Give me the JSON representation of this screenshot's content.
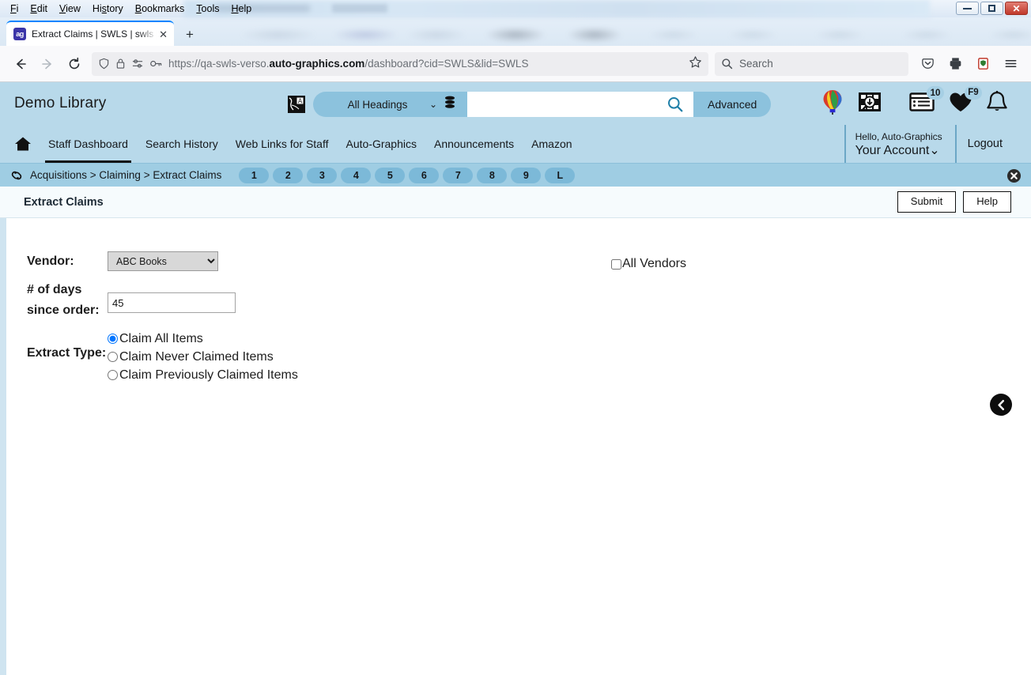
{
  "window": {
    "menus": [
      "File",
      "Edit",
      "View",
      "History",
      "Bookmarks",
      "Tools",
      "Help"
    ],
    "minimize_label": "Minimize",
    "maximize_label": "Maximize",
    "close_label": "Close"
  },
  "browser": {
    "tab": {
      "title": "Extract Claims | SWLS | swls | Au",
      "favicon_text": "ag",
      "close_label": "✕"
    },
    "new_tab_label": "+",
    "back_icon": "arrow-left-icon",
    "forward_icon": "arrow-right-icon",
    "reload_icon": "reload-icon",
    "url": {
      "prefix": "https://qa-swls-verso.",
      "domain": "auto-graphics.com",
      "suffix": "/dashboard?cid=SWLS&lid=SWLS"
    },
    "search": {
      "placeholder": "Search"
    }
  },
  "app": {
    "library_name": "Demo Library",
    "search": {
      "scope_label": "All Headings",
      "query": "",
      "advanced_label": "Advanced"
    },
    "header_icons": [
      {
        "name": "balloon-icon"
      },
      {
        "name": "image-search-icon"
      },
      {
        "name": "list-icon",
        "badge": "10"
      },
      {
        "name": "heart-icon",
        "badge": "F9"
      },
      {
        "name": "bell-icon",
        "badge": ""
      }
    ],
    "nav": [
      {
        "label": "Staff Dashboard",
        "active": true
      },
      {
        "label": "Search History",
        "active": false
      },
      {
        "label": "Web Links for Staff",
        "active": false
      },
      {
        "label": "Auto-Graphics",
        "active": false
      },
      {
        "label": "Announcements",
        "active": false
      },
      {
        "label": "Amazon",
        "active": false
      }
    ],
    "account": {
      "hello": "Hello, Auto-Graphics",
      "name": "Your Account",
      "logout": "Logout"
    },
    "breadcrumb": {
      "text": "Acquisitions > Claiming > Extract Claims",
      "pills": [
        "1",
        "2",
        "3",
        "4",
        "5",
        "6",
        "7",
        "8",
        "9",
        "L"
      ],
      "close_label": "✕"
    }
  },
  "page": {
    "title": "Extract Claims",
    "submit_label": "Submit",
    "help_label": "Help",
    "back_label": "Back"
  },
  "form": {
    "vendor_label": "Vendor:",
    "vendor_value": "ABC Books",
    "vendor_options": [
      "ABC Books"
    ],
    "all_vendors_label": "All Vendors",
    "all_vendors_checked": false,
    "days_label": "# of days since order:",
    "days_value": "45",
    "extract_type_label": "Extract Type:",
    "extract_types": [
      {
        "label": "Claim All Items",
        "selected": true
      },
      {
        "label": "Claim Never Claimed Items",
        "selected": false
      },
      {
        "label": "Claim Previously Claimed Items",
        "selected": false
      }
    ]
  },
  "colors": {
    "app_header": "#b8d9ea",
    "crumb_bar": "#9fcde3",
    "pill": "#7cb9d8",
    "accent_pill": "#8cc2dd",
    "badge": "#a6cfe4"
  }
}
